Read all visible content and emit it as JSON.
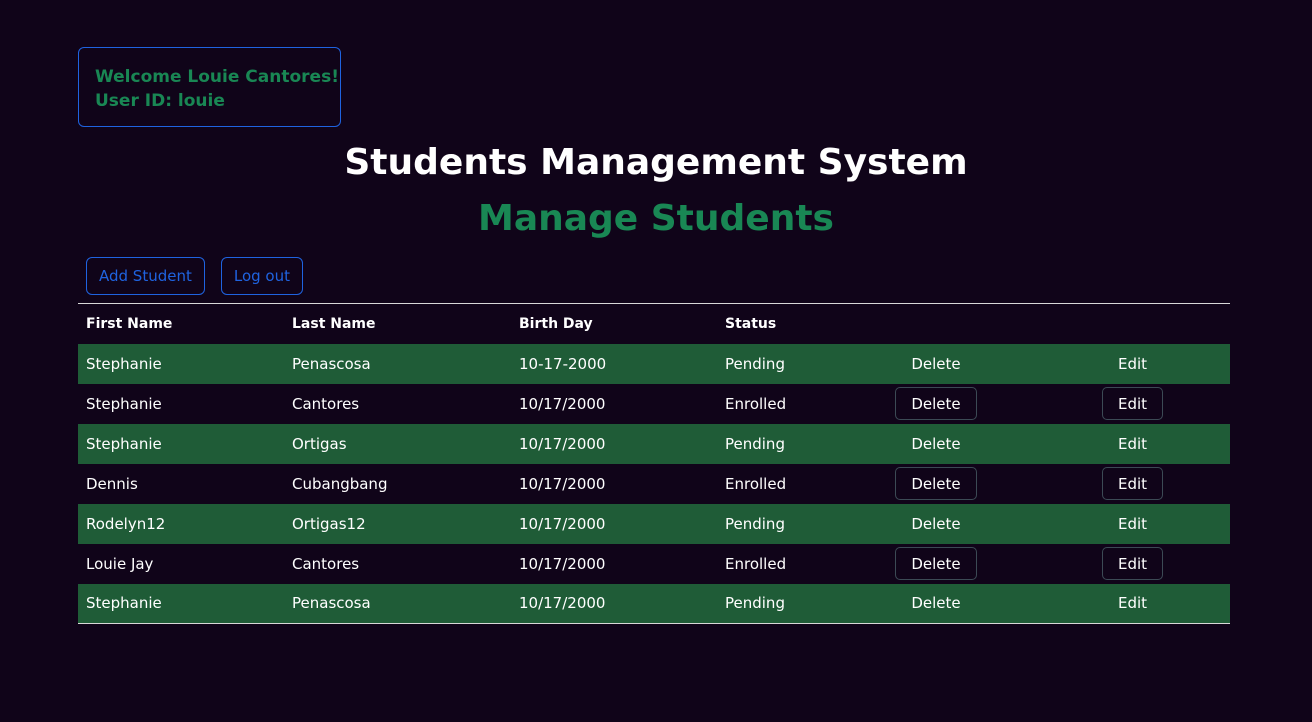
{
  "welcome": {
    "greeting": "Welcome Louie Cantores!",
    "user_id": "User ID: louie"
  },
  "header": {
    "title": "Students Management System",
    "subtitle": "Manage Students"
  },
  "toolbar": {
    "add_label": "Add Student",
    "logout_label": "Log out"
  },
  "table": {
    "columns": [
      "First Name",
      "Last Name",
      "Birth Day",
      "Status"
    ],
    "delete_label": "Delete",
    "edit_label": "Edit",
    "rows": [
      {
        "first": "Stephanie",
        "last": "Penascosa",
        "birthday": "10-17-2000",
        "status": "Pending"
      },
      {
        "first": "Stephanie",
        "last": "Cantores",
        "birthday": "10/17/2000",
        "status": "Enrolled"
      },
      {
        "first": "Stephanie",
        "last": "Ortigas",
        "birthday": "10/17/2000",
        "status": "Pending"
      },
      {
        "first": "Dennis",
        "last": "Cubangbang",
        "birthday": "10/17/2000",
        "status": "Enrolled"
      },
      {
        "first": "Rodelyn12",
        "last": "Ortigas12",
        "birthday": "10/17/2000",
        "status": "Pending"
      },
      {
        "first": "Louie Jay",
        "last": "Cantores",
        "birthday": "10/17/2000",
        "status": "Enrolled"
      },
      {
        "first": "Stephanie",
        "last": "Penascosa",
        "birthday": "10/17/2000",
        "status": "Pending"
      }
    ]
  },
  "colors": {
    "background": "#100419",
    "primary": "#1f63e0",
    "success": "#198754",
    "stripe": "#1f5c37"
  }
}
